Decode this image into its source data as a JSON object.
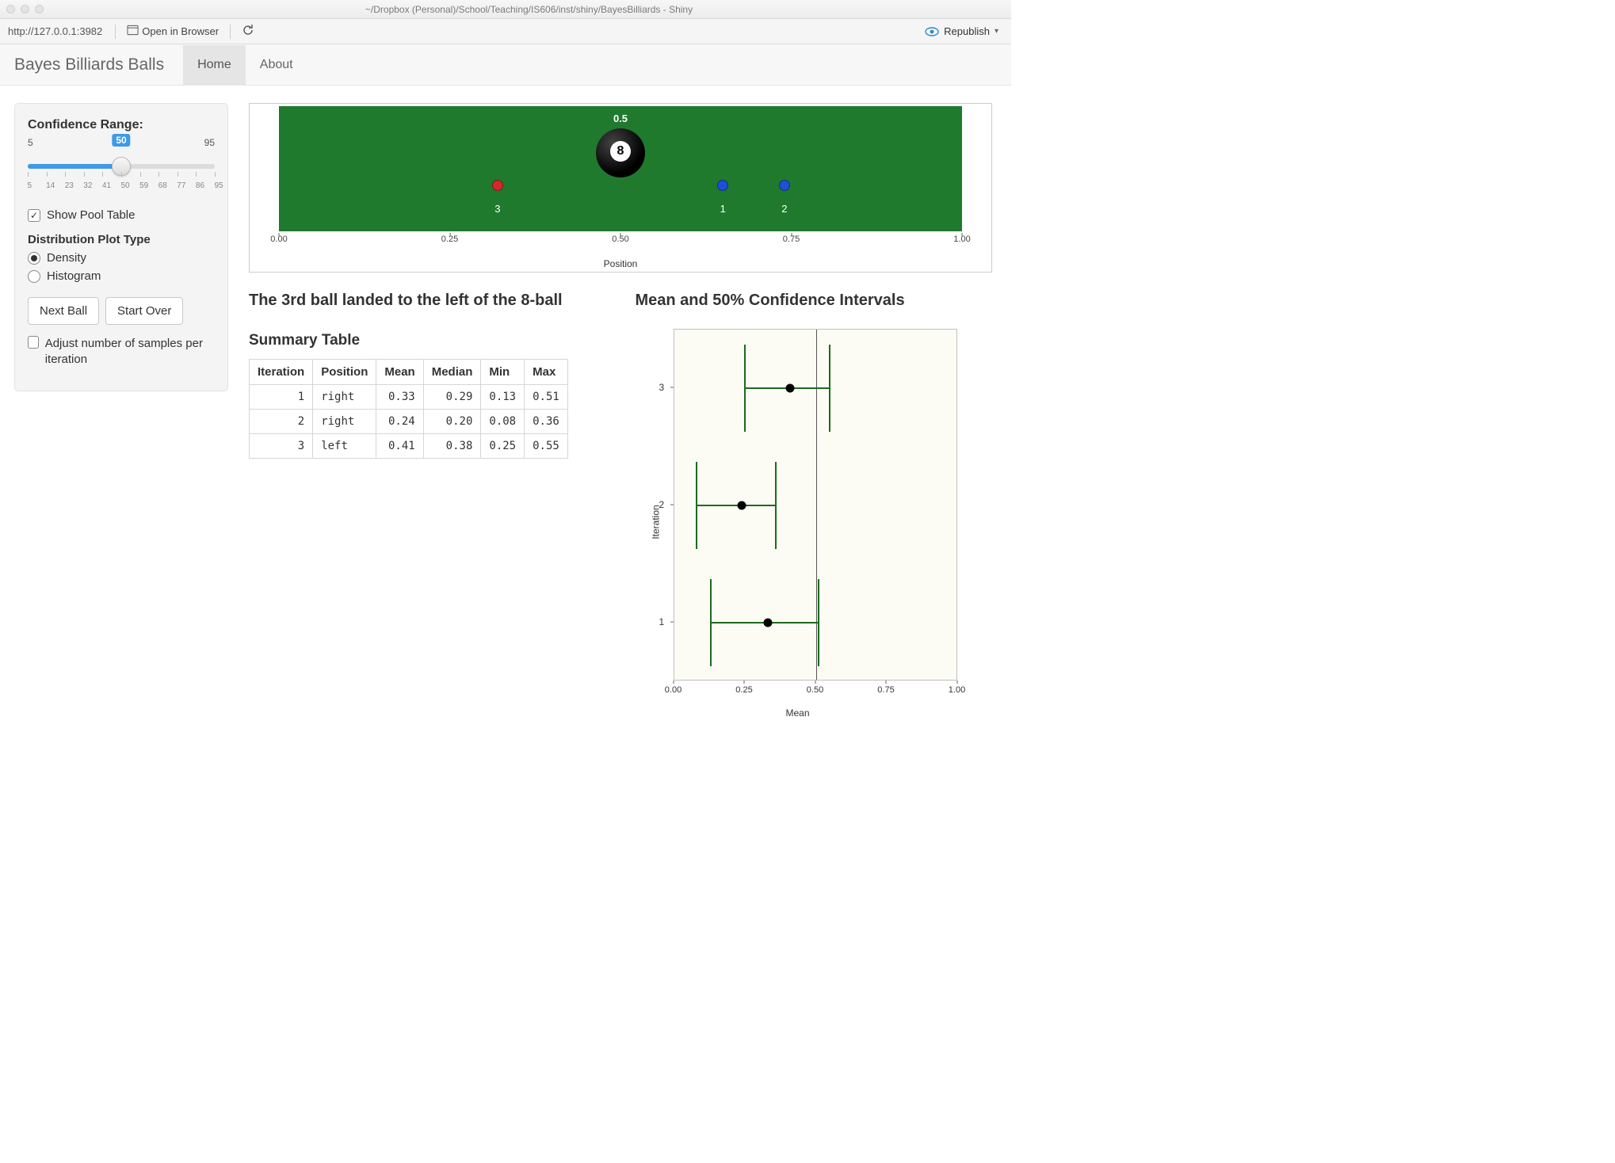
{
  "window": {
    "title": "~/Dropbox (Personal)/School/Teaching/IS606/inst/shiny/BayesBilliards - Shiny"
  },
  "viewer": {
    "url": "http://127.0.0.1:3982",
    "open_browser": "Open in Browser",
    "republish": "Republish"
  },
  "navbar": {
    "brand": "Bayes Billiards Balls",
    "tabs": [
      "Home",
      "About"
    ],
    "active": 0
  },
  "sidebar": {
    "conf_label": "Confidence Range:",
    "slider": {
      "min": 5,
      "max": 95,
      "value": 50,
      "tick_labels": [
        "5",
        "14",
        "23",
        "32",
        "41",
        "50",
        "59",
        "68",
        "77",
        "86",
        "95"
      ]
    },
    "show_pool": {
      "label": "Show Pool Table",
      "checked": true
    },
    "plot_type_label": "Distribution Plot Type",
    "plot_type_options": [
      "Density",
      "Histogram"
    ],
    "plot_type_selected": 0,
    "buttons": {
      "next": "Next Ball",
      "start_over": "Start Over"
    },
    "adjust_samples": {
      "label": "Adjust number of samples per iteration",
      "checked": false
    }
  },
  "pool": {
    "x_label": "Position",
    "x_ticks": [
      "0.00",
      "0.25",
      "0.50",
      "0.75",
      "1.00"
    ],
    "eight_ball": {
      "pos": 0.5,
      "label": "0.5",
      "number": "8"
    },
    "balls": [
      {
        "id": "3",
        "pos": 0.32,
        "color": "#d62828"
      },
      {
        "id": "1",
        "pos": 0.65,
        "color": "#1f4fd6"
      },
      {
        "id": "2",
        "pos": 0.74,
        "color": "#1f4fd6"
      }
    ]
  },
  "status_heading": "The 3rd ball landed to the left of the 8-ball",
  "ci_heading": "Mean and 50% Confidence Intervals",
  "summary": {
    "heading": "Summary Table",
    "columns": [
      "Iteration",
      "Position",
      "Mean",
      "Median",
      "Min",
      "Max"
    ],
    "rows": [
      {
        "Iteration": 1,
        "Position": "right",
        "Mean": "0.33",
        "Median": "0.29",
        "Min": "0.13",
        "Max": "0.51"
      },
      {
        "Iteration": 2,
        "Position": "right",
        "Mean": "0.24",
        "Median": "0.20",
        "Min": "0.08",
        "Max": "0.36"
      },
      {
        "Iteration": 3,
        "Position": "left",
        "Mean": "0.41",
        "Median": "0.38",
        "Min": "0.25",
        "Max": "0.55"
      }
    ]
  },
  "chart_data": [
    {
      "type": "scatter",
      "title": "Pool table ball positions",
      "xlabel": "Position",
      "ylabel": "",
      "xlim": [
        0,
        1
      ],
      "series": [
        {
          "name": "8-ball",
          "x": [
            0.5
          ]
        },
        {
          "name": "ball-1",
          "x": [
            0.65
          ]
        },
        {
          "name": "ball-2",
          "x": [
            0.74
          ]
        },
        {
          "name": "ball-3",
          "x": [
            0.32
          ]
        }
      ]
    },
    {
      "type": "scatter",
      "title": "Mean and 50% Confidence Intervals",
      "xlabel": "Mean",
      "ylabel": "Iteration",
      "xlim": [
        0,
        1
      ],
      "ylim": [
        0.5,
        3.5
      ],
      "x_ticks": [
        0.0,
        0.25,
        0.5,
        0.75,
        1.0
      ],
      "y_ticks": [
        1,
        2,
        3
      ],
      "reference_line_x": 0.5,
      "series": [
        {
          "name": "iter-1",
          "y": 1,
          "mean": 0.33,
          "low": 0.13,
          "high": 0.51
        },
        {
          "name": "iter-2",
          "y": 2,
          "mean": 0.24,
          "low": 0.08,
          "high": 0.36
        },
        {
          "name": "iter-3",
          "y": 3,
          "mean": 0.41,
          "low": 0.25,
          "high": 0.55
        }
      ]
    }
  ]
}
